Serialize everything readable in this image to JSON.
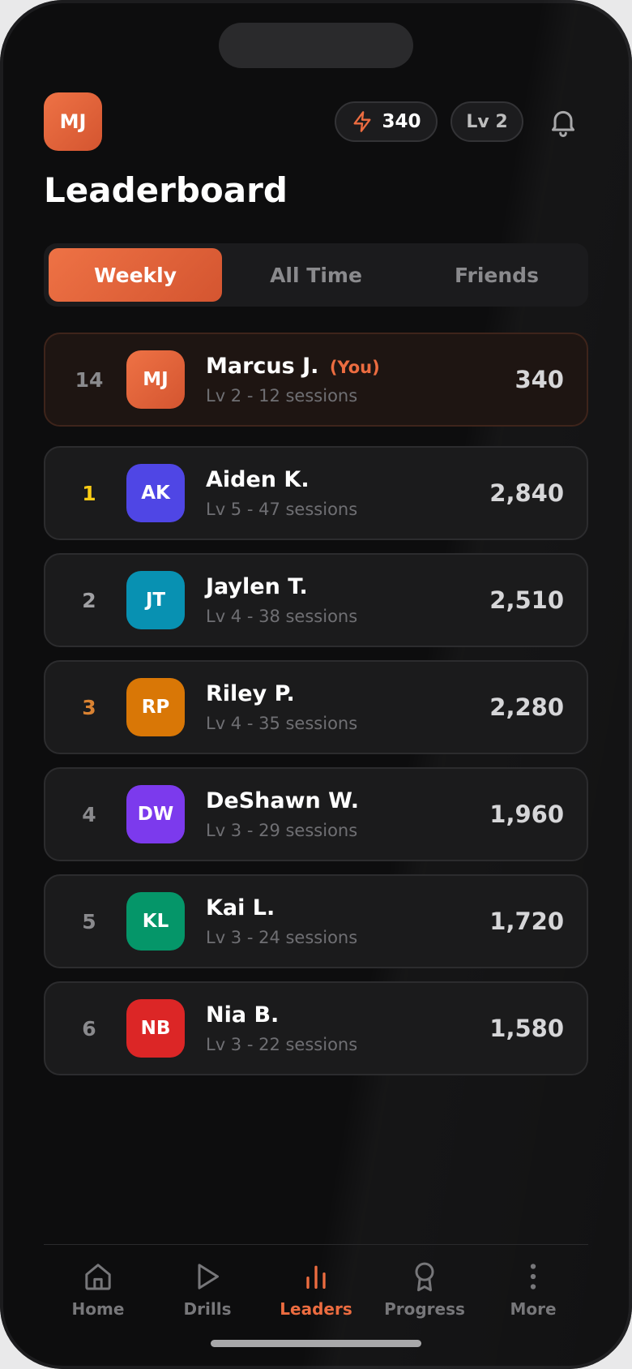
{
  "header": {
    "avatar_initials": "MJ",
    "xp": "340",
    "level": "Lv 2",
    "icons": {
      "xp": "bolt-icon",
      "notifications": "bell-icon"
    }
  },
  "title": "Leaderboard",
  "tabs": [
    {
      "label": "Weekly",
      "active": true
    },
    {
      "label": "All Time",
      "active": false
    },
    {
      "label": "Friends",
      "active": false
    }
  ],
  "current_user": {
    "rank": "14",
    "initials": "MJ",
    "name": "Marcus J.",
    "you_label": "(You)",
    "subtitle": "Lv 2 - 12 sessions",
    "score": "340",
    "avatar_color": "#e8643a"
  },
  "entries": [
    {
      "rank": "1",
      "initials": "AK",
      "name": "Aiden K.",
      "subtitle": "Lv 5 - 47 sessions",
      "score": "2,840",
      "avatar_color": "#4f46e5",
      "rank_color": "#facc15"
    },
    {
      "rank": "2",
      "initials": "JT",
      "name": "Jaylen T.",
      "subtitle": "Lv 4 - 38 sessions",
      "score": "2,510",
      "avatar_color": "#0891b2",
      "rank_color": "#a1a1a4"
    },
    {
      "rank": "3",
      "initials": "RP",
      "name": "Riley P.",
      "subtitle": "Lv 4 - 35 sessions",
      "score": "2,280",
      "avatar_color": "#d97706",
      "rank_color": "#d98232"
    },
    {
      "rank": "4",
      "initials": "DW",
      "name": "DeShawn W.",
      "subtitle": "Lv 3 - 29 sessions",
      "score": "1,960",
      "avatar_color": "#7c3aed",
      "rank_color": "#6f6f73"
    },
    {
      "rank": "5",
      "initials": "KL",
      "name": "Kai L.",
      "subtitle": "Lv 3 - 24 sessions",
      "score": "1,720",
      "avatar_color": "#059669",
      "rank_color": "#6f6f73"
    },
    {
      "rank": "6",
      "initials": "NB",
      "name": "Nia B.",
      "subtitle": "Lv 3 - 22 sessions",
      "score": "1,580",
      "avatar_color": "#dc2626",
      "rank_color": "#6f6f73"
    }
  ],
  "nav": [
    {
      "label": "Home",
      "icon": "home-icon",
      "active": false
    },
    {
      "label": "Drills",
      "icon": "play-icon",
      "active": false
    },
    {
      "label": "Leaders",
      "icon": "bar-chart-icon",
      "active": true
    },
    {
      "label": "Progress",
      "icon": "award-icon",
      "active": false
    },
    {
      "label": "More",
      "icon": "more-vertical-icon",
      "active": false
    }
  ],
  "colors": {
    "accent": "#e8643a",
    "background": "#0d0d0e",
    "card": "#1b1b1c"
  }
}
